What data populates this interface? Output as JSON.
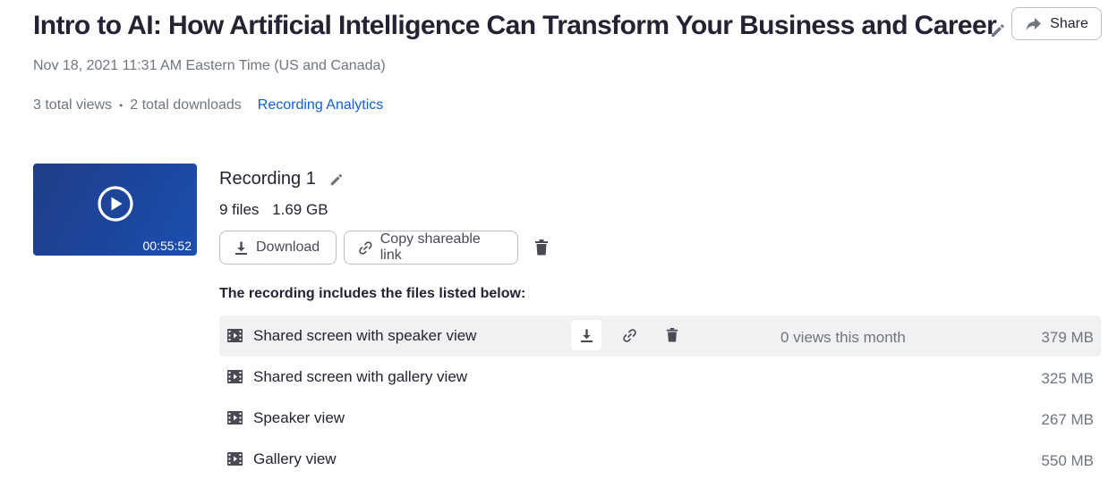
{
  "header": {
    "title": "Intro to AI: How Artificial Intelligence Can Transform Your Business and Career",
    "share_label": "Share",
    "date": "Nov 18, 2021 11:31 AM Eastern Time (US and Canada)"
  },
  "stats": {
    "views": "3 total views",
    "separator": "•",
    "downloads": "2 total downloads",
    "analytics_link": "Recording Analytics"
  },
  "recording": {
    "name": "Recording 1",
    "files_count": "9 files",
    "total_size": "1.69 GB",
    "duration": "00:55:52",
    "download_label": "Download",
    "copy_link_label": "Copy shareable link",
    "files_heading": "The recording includes the files listed below:"
  },
  "files": [
    {
      "name": "Shared screen with speaker view",
      "views": "0 views this month",
      "size": "379 MB"
    },
    {
      "name": "Shared screen with gallery view",
      "size": "325 MB"
    },
    {
      "name": "Speaker view",
      "size": "267 MB"
    },
    {
      "name": "Gallery view",
      "size": "550 MB"
    }
  ],
  "colors": {
    "text": "#232333",
    "muted": "#6e7680",
    "link": "#0e5fd8",
    "thumbnail": "#1d47a0",
    "row_hover": "#f1f1f4"
  },
  "icons": {
    "title_edit": "pencil-icon",
    "share": "share-arrow-icon",
    "play": "play-circle-icon",
    "download": "download-icon",
    "link": "link-icon",
    "delete": "trash-icon",
    "file": "video-file-icon"
  }
}
